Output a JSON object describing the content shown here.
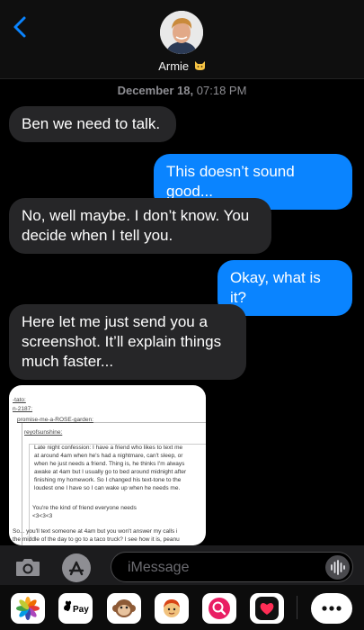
{
  "header": {
    "contact_name": "Armie",
    "icons": [
      "back-chevron-icon",
      "contact-avatar",
      "cat-emoji-icon"
    ]
  },
  "thread": {
    "timestamp_date": "December 18,",
    "timestamp_time": "07:18 PM",
    "messages": [
      {
        "from": "them",
        "text": "Ben we need to talk."
      },
      {
        "from": "me",
        "text": "This doesn’t sound good..."
      },
      {
        "from": "them",
        "text": "No, well maybe. I don’t know. You decide when I tell you."
      },
      {
        "from": "me",
        "text": "Okay, what is it?"
      },
      {
        "from": "them",
        "text": "Here let me just send you a screenshot. It’ll explain things much faster..."
      }
    ],
    "attachment": {
      "lines": [
        "-tato:",
        "n-2187:",
        "promise-me-a-ROSE-garden:",
        "reyofsunshine:",
        "Late night confession: I have a friend who likes to text me",
        "at around 4am when he's had a nightmare, can't sleep, or",
        "when he just needs a friend. Thing is, he thinks I'm always",
        "awake at 4am but I usually go to bed around midnight after",
        "finishing my homework. So I changed his text-tone to the",
        "loudest one I have so I can wake up when he needs me.",
        "You're the kind of friend everyone needs",
        "<3<3<3",
        "So... you'll text someone at 4am but you won't answer my calls i",
        "the middle of the day to go to a taco truck? I see how it is, peanu"
      ]
    }
  },
  "composer": {
    "placeholder": "iMessage",
    "icons": [
      "camera-icon",
      "app-store-icon",
      "audio-waveform-icon"
    ]
  },
  "app_tray": {
    "apple_pay_label": "Pay",
    "apps": [
      "photos-app-icon",
      "apple-pay-icon",
      "memoji-monkey-icon",
      "memoji-icon",
      "image-search-icon",
      "digital-touch-icon",
      "more-apps-icon"
    ]
  }
}
